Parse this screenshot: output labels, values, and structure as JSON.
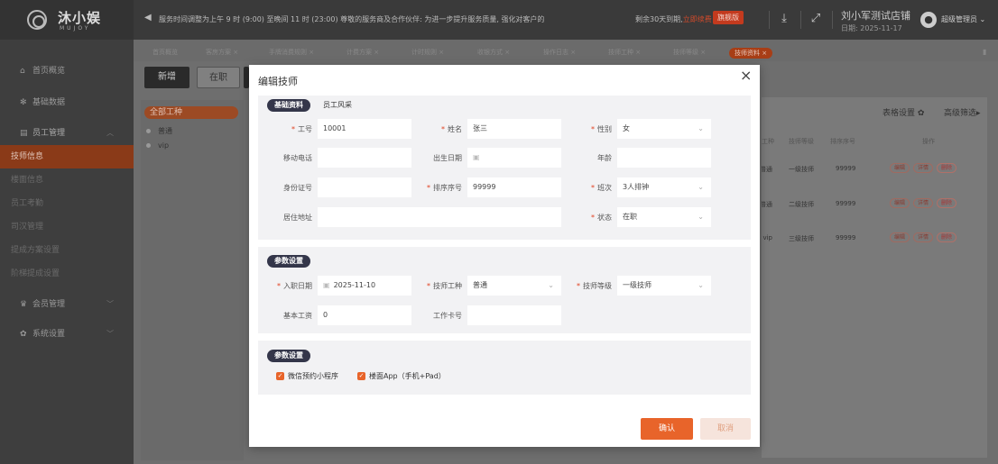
{
  "brand": {
    "name": "沐小娱",
    "sub": "MUJOY"
  },
  "notice": "服务时间调整为上午 9 时 (9:00) 至晚间 11 时 (23:00) 尊敬的服务商及合作伙伴: 为进一步提升服务质量, 强化对客户的",
  "expire": {
    "text": "剩余30天到期,",
    "link": "立即续费",
    "version": "旗舰版"
  },
  "user": {
    "store": "刘小军测试店铺",
    "date": "日期: 2025-11-17",
    "role": "超级管理员"
  },
  "sidebar": {
    "items": [
      {
        "label": "首页概览",
        "icon": "home-icon"
      },
      {
        "label": "基础数据",
        "icon": "gear-icon"
      },
      {
        "label": "员工管理",
        "icon": "staff-icon"
      },
      {
        "label": "技师信息"
      },
      {
        "label": "楼面信息"
      },
      {
        "label": "员工考勤"
      },
      {
        "label": "司汉管理"
      },
      {
        "label": "提成方案设置"
      },
      {
        "label": "阶梯提成设置"
      },
      {
        "label": "会员管理",
        "icon": "crown-icon"
      },
      {
        "label": "系统设置",
        "icon": "gear-icon"
      }
    ]
  },
  "tabs": [
    "首页概览",
    "客房方案 ×",
    "手牌消费规则 ×",
    "计费方案 ×",
    "计时规则 ×",
    "收银方式 ×",
    "操作日志 ×",
    "技师工种 ×",
    "技师等级 ×",
    "技师资料 ×"
  ],
  "toolbar": {
    "add": "新增",
    "status": "在职"
  },
  "tree": {
    "head": "全部工种",
    "nodes": [
      "普通",
      "vip"
    ]
  },
  "table": {
    "settings": "表格设置",
    "filter": "高级筛选",
    "headers": [
      "工种",
      "技师等级",
      "排序序号",
      "操作"
    ],
    "rows": [
      {
        "type": "普通",
        "level": "一级技师",
        "order": "99999"
      },
      {
        "type": "普通",
        "level": "二级技师",
        "order": "99999"
      },
      {
        "type": "vip",
        "level": "三级技师",
        "order": "99999"
      }
    ],
    "actions": {
      "edit": "编辑",
      "detail": "详情",
      "delete": "删除"
    }
  },
  "modal": {
    "title": "编辑技师",
    "close": "×",
    "tabs": {
      "basic": "基础资料",
      "style": "员工风采"
    },
    "fields": {
      "job_no": {
        "label": "工号",
        "value": "10001"
      },
      "name": {
        "label": "姓名",
        "value": "张三"
      },
      "gender": {
        "label": "性别",
        "value": "女"
      },
      "phone": {
        "label": "移动电话",
        "value": ""
      },
      "birthday": {
        "label": "出生日期",
        "value": ""
      },
      "age": {
        "label": "年龄",
        "value": ""
      },
      "id_card": {
        "label": "身份证号",
        "value": ""
      },
      "order": {
        "label": "排序序号",
        "value": "99999"
      },
      "shift": {
        "label": "班次",
        "value": "3人排钟"
      },
      "address": {
        "label": "居住地址",
        "value": ""
      },
      "status": {
        "label": "状态",
        "value": "在职"
      },
      "entry_date": {
        "label": "入职日期",
        "value": "2025-11-10"
      },
      "job_type": {
        "label": "技师工种",
        "value": "普通"
      },
      "level": {
        "label": "技师等级",
        "value": "一级技师"
      },
      "salary": {
        "label": "基本工资",
        "value": "0"
      },
      "card": {
        "label": "工作卡号",
        "value": ""
      }
    },
    "section2": "参数设置",
    "section3": "参数设置",
    "checks": {
      "wechat": "微信预约小程序",
      "app": "楼面App（手机+Pad）"
    },
    "ok": "确认",
    "cancel": "取消"
  },
  "colors": {
    "accent": "#e8642a",
    "pill": "#34364a"
  }
}
